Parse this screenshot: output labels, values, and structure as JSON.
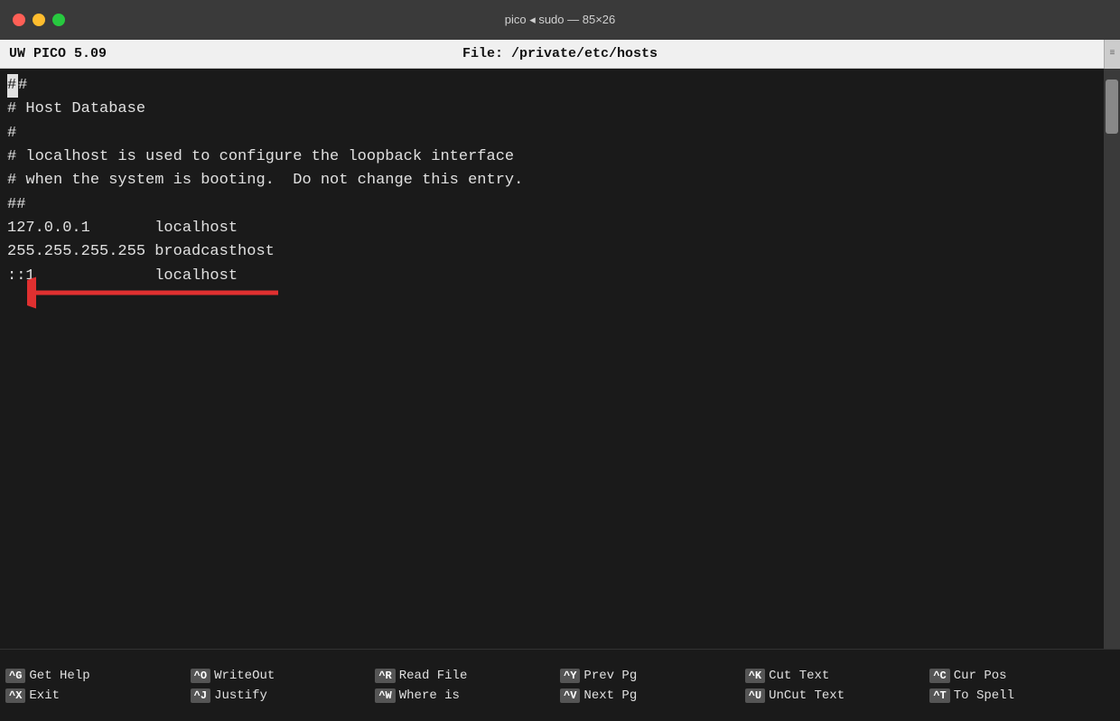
{
  "titlebar": {
    "text": "pico ◂ sudo — 85×26"
  },
  "statusbar": {
    "left": "UW PICO 5.09",
    "center": "File: /private/etc/hosts"
  },
  "editor": {
    "lines": [
      "##",
      "# Host Database",
      "#",
      "# localhost is used to configure the loopback interface",
      "# when the system is booting.  Do not change this entry.",
      "##",
      "127.0.0.1       localhost",
      "255.255.255.255 broadcasthost",
      "::1             localhost"
    ]
  },
  "menubar": {
    "columns": [
      {
        "items": [
          {
            "key": "^G",
            "label": "Get Help"
          },
          {
            "key": "^X",
            "label": "Exit"
          }
        ]
      },
      {
        "items": [
          {
            "key": "^O",
            "label": "WriteOut"
          },
          {
            "key": "^J",
            "label": "Justify"
          }
        ]
      },
      {
        "items": [
          {
            "key": "^R",
            "label": "Read File"
          },
          {
            "key": "^W",
            "label": "Where is"
          }
        ]
      },
      {
        "items": [
          {
            "key": "^Y",
            "label": "Prev Pg"
          },
          {
            "key": "^V",
            "label": "Next Pg"
          }
        ]
      },
      {
        "items": [
          {
            "key": "^K",
            "label": "Cut Text"
          },
          {
            "key": "^U",
            "label": "UnCut Text"
          }
        ]
      },
      {
        "items": [
          {
            "key": "^C",
            "label": "Cur Pos"
          },
          {
            "key": "^T",
            "label": "To Spell"
          }
        ]
      }
    ]
  }
}
